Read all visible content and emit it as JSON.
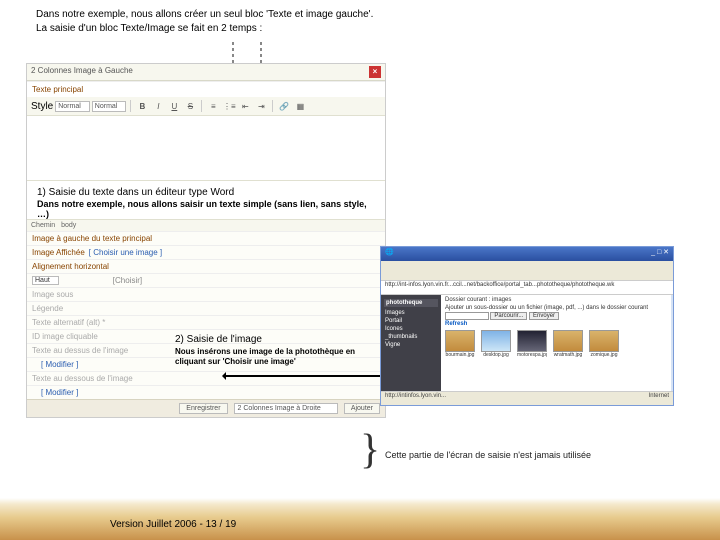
{
  "intro": {
    "line1": "Dans notre exemple, nous allons créer un seul bloc 'Texte et image gauche'.",
    "line2": "La saisie d'un bloc Texte/Image se fait en 2 temps :"
  },
  "editor": {
    "window_title": "2 Colonnes Image à Gauche",
    "section_main": "Texte principal",
    "style_label": "Style",
    "style_value": "Normal",
    "font_value": "Normal",
    "icons": {
      "bold": "B",
      "italic": "I",
      "underline": "U",
      "strike": "S"
    },
    "path_label": "Chemin",
    "path_value": "body",
    "row_image_left": "Image à gauche du texte principal",
    "row_image_shown": "Image Affichée",
    "choose_link": "[ Choisir une image ]",
    "row_align_h": "Alignement horizontal",
    "align_value": "Haut",
    "chosen_label": "[Choisir]",
    "row_image_title": "Image sous",
    "row_legend": "Légende",
    "row_alt": "Texte alternatif (alt) *",
    "row_id_clickable": "ID image cliquable",
    "row_text_above": "Texte au dessus de l'image",
    "edit_link": "[ Modifier ]",
    "row_text_below": "Texte au dessous de l'image",
    "save_btn": "Enregistrer",
    "cols_value": "2 Colonnes Image à Droite",
    "add_btn": "Ajouter"
  },
  "note1": {
    "heading": "1) Saisie du texte dans un éditeur type Word",
    "sub": "Dans notre exemple, nous allons saisir un texte simple (sans lien, sans style, …)"
  },
  "note2": {
    "heading": "2) Saisie de l'image",
    "sub": "Nous insérons une image de la photothèque en cliquant sur 'Choisir une image'"
  },
  "popup": {
    "title": "phototheque",
    "addr": "http://int-infos.lyon.vin.fr...ccil...net/backoffice/portal_tab...phototheque/phototheque.wk",
    "side_header": "phototheque",
    "side_items": [
      "Images",
      "Portail",
      "Icones",
      "_thumbnails",
      "Vigne"
    ],
    "main_line1": "Dossier courant : images",
    "main_line2": "Ajouter un sous-dossier ou un fichier (image, pdf, ...) dans le dossier courant",
    "browse": "Parcourir...",
    "send": "Envoyer",
    "refresh": "Refresh",
    "thumbs": [
      "bourmain.jpg",
      "desktop.jpg",
      "motorespa.jpg",
      "wratmath.jpg",
      "zomique.jpg"
    ],
    "status_left": "http://intinfos.lyon.vin...",
    "status_right": "Internet"
  },
  "brace_text": "Cette partie de l'écran de saisie n'est jamais utilisée",
  "footer": "Version Juillet 2006 - 13 / 19"
}
